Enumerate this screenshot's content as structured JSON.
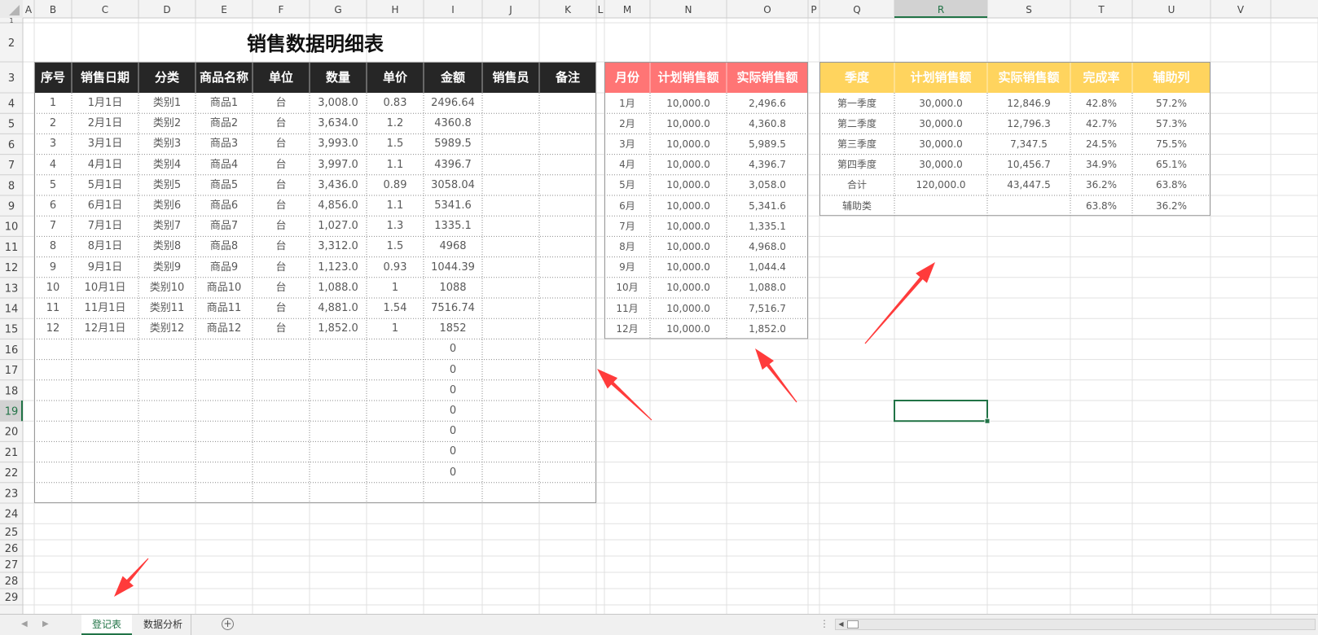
{
  "app": {
    "name": "Excel"
  },
  "columns": [
    "A",
    "B",
    "C",
    "D",
    "E",
    "F",
    "G",
    "H",
    "I",
    "J",
    "K",
    "L",
    "M",
    "N",
    "O",
    "P",
    "Q",
    "R",
    "S",
    "T",
    "U",
    "V"
  ],
  "rows": [
    1,
    2,
    3,
    4,
    5,
    6,
    7,
    8,
    9,
    10,
    11,
    12,
    13,
    14,
    15,
    16,
    17,
    18,
    19,
    20,
    21,
    22,
    23,
    24,
    25,
    26,
    27,
    28,
    29
  ],
  "selection": {
    "cell": "R19",
    "column": "R",
    "row": 19
  },
  "colors": {
    "header_dark": "#262626",
    "header_pink": "#ff7575",
    "header_gold": "#ffd45e",
    "excel_green": "#217346",
    "arrow": "#ff3b3b",
    "grid_line": "#e1e1e1",
    "header_bg": "#f3f3f3"
  },
  "table1": {
    "title": "销售数据明细表",
    "headers": [
      "序号",
      "销售日期",
      "分类",
      "商品名称",
      "单位",
      "数量",
      "单价",
      "金额",
      "销售员",
      "备注"
    ],
    "rows": [
      [
        "1",
        "1月1日",
        "类别1",
        "商品1",
        "台",
        "3,008.0",
        "0.83",
        "2496.64",
        "",
        ""
      ],
      [
        "2",
        "2月1日",
        "类别2",
        "商品2",
        "台",
        "3,634.0",
        "1.2",
        "4360.8",
        "",
        ""
      ],
      [
        "3",
        "3月1日",
        "类别3",
        "商品3",
        "台",
        "3,993.0",
        "1.5",
        "5989.5",
        "",
        ""
      ],
      [
        "4",
        "4月1日",
        "类别4",
        "商品4",
        "台",
        "3,997.0",
        "1.1",
        "4396.7",
        "",
        ""
      ],
      [
        "5",
        "5月1日",
        "类别5",
        "商品5",
        "台",
        "3,436.0",
        "0.89",
        "3058.04",
        "",
        ""
      ],
      [
        "6",
        "6月1日",
        "类别6",
        "商品6",
        "台",
        "4,856.0",
        "1.1",
        "5341.6",
        "",
        ""
      ],
      [
        "7",
        "7月1日",
        "类别7",
        "商品7",
        "台",
        "1,027.0",
        "1.3",
        "1335.1",
        "",
        ""
      ],
      [
        "8",
        "8月1日",
        "类别8",
        "商品8",
        "台",
        "3,312.0",
        "1.5",
        "4968",
        "",
        ""
      ],
      [
        "9",
        "9月1日",
        "类别9",
        "商品9",
        "台",
        "1,123.0",
        "0.93",
        "1044.39",
        "",
        ""
      ],
      [
        "10",
        "10月1日",
        "类别10",
        "商品10",
        "台",
        "1,088.0",
        "1",
        "1088",
        "",
        ""
      ],
      [
        "11",
        "11月1日",
        "类别11",
        "商品11",
        "台",
        "4,881.0",
        "1.54",
        "7516.74",
        "",
        ""
      ],
      [
        "12",
        "12月1日",
        "类别12",
        "商品12",
        "台",
        "1,852.0",
        "1",
        "1852",
        "",
        ""
      ],
      [
        "",
        "",
        "",
        "",
        "",
        "",
        "",
        "0",
        "",
        ""
      ],
      [
        "",
        "",
        "",
        "",
        "",
        "",
        "",
        "0",
        "",
        ""
      ],
      [
        "",
        "",
        "",
        "",
        "",
        "",
        "",
        "0",
        "",
        ""
      ],
      [
        "",
        "",
        "",
        "",
        "",
        "",
        "",
        "0",
        "",
        ""
      ],
      [
        "",
        "",
        "",
        "",
        "",
        "",
        "",
        "0",
        "",
        ""
      ],
      [
        "",
        "",
        "",
        "",
        "",
        "",
        "",
        "0",
        "",
        ""
      ],
      [
        "",
        "",
        "",
        "",
        "",
        "",
        "",
        "0",
        "",
        ""
      ],
      [
        "",
        "",
        "",
        "",
        "",
        "",
        "",
        "",
        "",
        ""
      ]
    ]
  },
  "table2": {
    "headers": [
      "月份",
      "计划销售额",
      "实际销售额"
    ],
    "rows": [
      [
        "1月",
        "10,000.0",
        "2,496.6"
      ],
      [
        "2月",
        "10,000.0",
        "4,360.8"
      ],
      [
        "3月",
        "10,000.0",
        "5,989.5"
      ],
      [
        "4月",
        "10,000.0",
        "4,396.7"
      ],
      [
        "5月",
        "10,000.0",
        "3,058.0"
      ],
      [
        "6月",
        "10,000.0",
        "5,341.6"
      ],
      [
        "7月",
        "10,000.0",
        "1,335.1"
      ],
      [
        "8月",
        "10,000.0",
        "4,968.0"
      ],
      [
        "9月",
        "10,000.0",
        "1,044.4"
      ],
      [
        "10月",
        "10,000.0",
        "1,088.0"
      ],
      [
        "11月",
        "10,000.0",
        "7,516.7"
      ],
      [
        "12月",
        "10,000.0",
        "1,852.0"
      ]
    ]
  },
  "table3": {
    "headers": [
      "季度",
      "计划销售额",
      "实际销售额",
      "完成率",
      "辅助列"
    ],
    "rows": [
      [
        "第一季度",
        "30,000.0",
        "12,846.9",
        "42.8%",
        "57.2%"
      ],
      [
        "第二季度",
        "30,000.0",
        "12,796.3",
        "42.7%",
        "57.3%"
      ],
      [
        "第三季度",
        "30,000.0",
        "7,347.5",
        "24.5%",
        "75.5%"
      ],
      [
        "第四季度",
        "30,000.0",
        "10,456.7",
        "34.9%",
        "65.1%"
      ],
      [
        "合计",
        "120,000.0",
        "43,447.5",
        "36.2%",
        "63.8%"
      ],
      [
        "辅助类",
        "",
        "",
        "63.8%",
        "36.2%"
      ]
    ]
  },
  "sheet_tabs": [
    "登记表",
    "数据分析"
  ],
  "active_sheet": "登记表",
  "status": {
    "add_sheet_icon": "plus-circle-icon",
    "dots_icon": "vertical-dots-icon"
  }
}
